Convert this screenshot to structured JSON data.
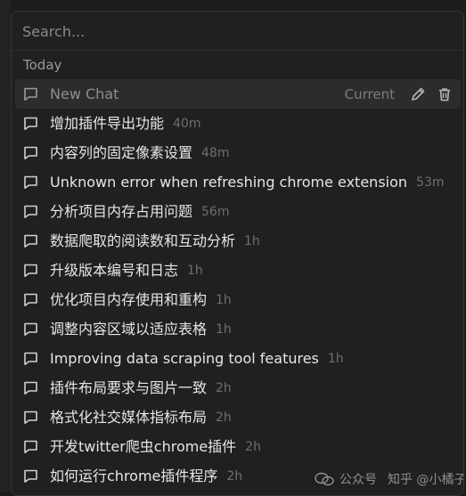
{
  "search": {
    "placeholder": "Search..."
  },
  "section": {
    "label": "Today"
  },
  "active_item": {
    "title": "New Chat",
    "status": "Current"
  },
  "items": [
    {
      "title": "增加插件导出功能",
      "time": "40m"
    },
    {
      "title": "内容列的固定像素设置",
      "time": "48m"
    },
    {
      "title": "Unknown error when refreshing chrome extension",
      "time": "53m"
    },
    {
      "title": "分析项目内存占用问题",
      "time": "56m"
    },
    {
      "title": "数据爬取的阅读数和互动分析",
      "time": "1h"
    },
    {
      "title": "升级版本编号和日志",
      "time": "1h"
    },
    {
      "title": "优化项目内存使用和重构",
      "time": "1h"
    },
    {
      "title": "调整内容区域以适应表格",
      "time": "1h"
    },
    {
      "title": "Improving data scraping tool features",
      "time": "1h"
    },
    {
      "title": "插件布局要求与图片一致",
      "time": "2h"
    },
    {
      "title": "格式化社交媒体指标布局",
      "time": "2h"
    },
    {
      "title": "开发twitter爬虫chrome插件",
      "time": "2h"
    },
    {
      "title": "如何运行chrome插件程序",
      "time": "2h"
    }
  ],
  "watermark": {
    "left": "公众号",
    "right": "知乎 @小橘子"
  },
  "icons": {
    "chat": "chat-bubble-icon",
    "edit": "pencil-icon",
    "delete": "trash-icon"
  },
  "colors": {
    "panel_bg": "#202020",
    "active_bg": "#2c2c2c",
    "text": "#e6e6e6",
    "muted": "#6f6f6f"
  }
}
